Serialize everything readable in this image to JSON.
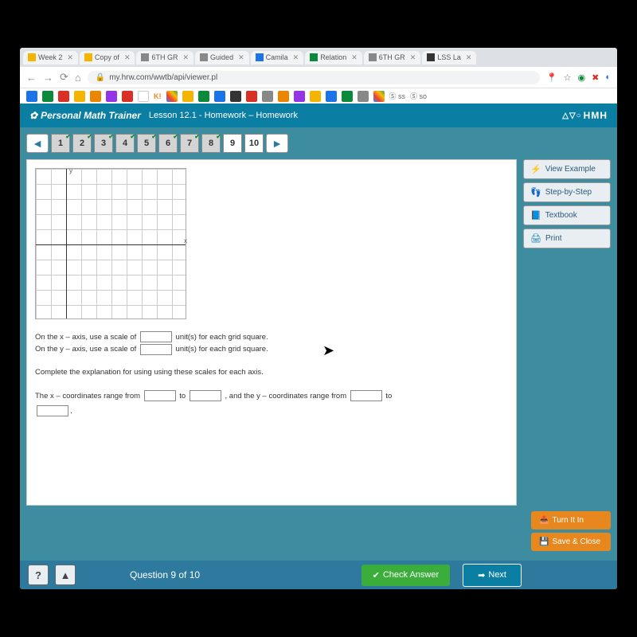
{
  "browser": {
    "tabs": [
      {
        "label": "Week 2",
        "fav": "#f4b400"
      },
      {
        "label": "Copy of",
        "fav": "#f4b400"
      },
      {
        "label": "6TH GR",
        "fav": "#888"
      },
      {
        "label": "Guided",
        "fav": "#888"
      },
      {
        "label": "Camila",
        "fav": "#1a73e8"
      },
      {
        "label": "Relation",
        "fav": "#0a8a3a"
      },
      {
        "label": "6TH GR",
        "fav": "#888"
      },
      {
        "label": "LSS La",
        "fav": "#333"
      }
    ],
    "url": "my.hrw.com/wwtb/api/viewer.pl",
    "lock": "🔒"
  },
  "app": {
    "brand": "Personal Math Trainer",
    "lesson": "Lesson 12.1 - Homework – Homework",
    "logo": "HMH",
    "logo_tri": "△▽○"
  },
  "nav": {
    "prev": "◄",
    "next": "►",
    "questions": [
      {
        "n": "1",
        "done": true
      },
      {
        "n": "2",
        "done": true
      },
      {
        "n": "3",
        "done": true
      },
      {
        "n": "4",
        "done": true
      },
      {
        "n": "5",
        "done": true
      },
      {
        "n": "6",
        "done": true
      },
      {
        "n": "7",
        "done": true
      },
      {
        "n": "8",
        "done": true
      },
      {
        "n": "9",
        "done": false,
        "current": true
      },
      {
        "n": "10",
        "done": false
      }
    ]
  },
  "question": {
    "y_label": "y",
    "x_label": "x",
    "line1_a": "On the x – axis, use a scale of",
    "line1_b": "unit(s) for each grid square.",
    "line2_a": "On the y – axis, use a scale of",
    "line2_b": "unit(s) for each grid square.",
    "line3": "Complete the explanation for using using these scales for each axis.",
    "line4_a": "The x – coordinates range from",
    "line4_b": "to",
    "line4_c": ", and the y – coordinates range from",
    "line4_d": "to"
  },
  "help": {
    "view": "View Example",
    "step": "Step-by-Step",
    "textbook": "Textbook",
    "print": "Print"
  },
  "submit": {
    "turn": "Turn It In",
    "save": "Save & Close"
  },
  "footer": {
    "help": "?",
    "warn": "▲",
    "qof": "Question 9 of 10",
    "check": "Check Answer",
    "next": "Next"
  }
}
